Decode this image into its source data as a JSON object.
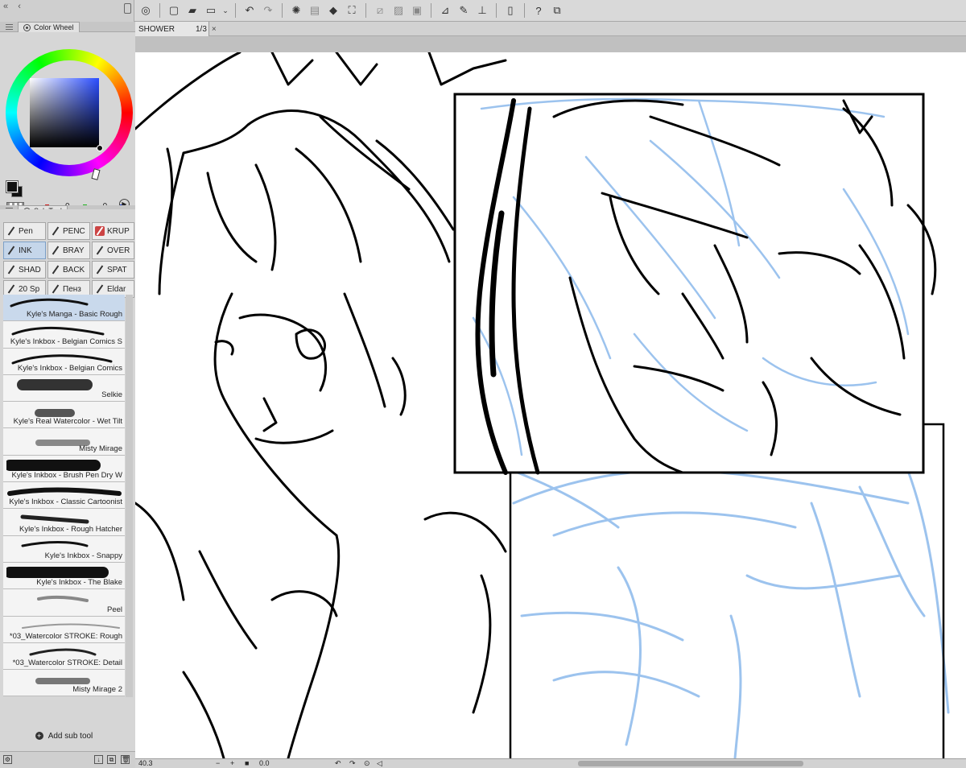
{
  "palette": {
    "color_wheel_tab": "Color Wheel",
    "rgb": {
      "r": "0",
      "g": "0",
      "b": "0"
    },
    "sub_tool_tab": "Sub Tool"
  },
  "subtool_buttons": [
    "Pen",
    "PENC",
    "KRUP",
    "INK",
    "BRAY",
    "OVER",
    "SHAD",
    "BACK",
    "SPAT",
    "20 Sp",
    "Пенз",
    "Eldar"
  ],
  "brushes": [
    "Kyle's Manga - Basic Rough",
    "Kyle's Inkbox - Belgian Comics S",
    "Kyle's Inkbox - Belgian Comics",
    "Selkie",
    "Kyle's Real Watercolor - Wet Tilt",
    "Misty Mirage",
    "Kyle's Inkbox - Brush Pen Dry W",
    "Kyle's Inkbox - Classic Cartoonist",
    "Kyle's Inkbox - Rough Hatcher",
    "Kyle's Inkbox - Snappy",
    "Kyle's Inkbox - The Blake",
    "Peel",
    "*03_Watercolor STROKE: Rough",
    "*03_Watercolor STROKE: Detail",
    "Misty Mirage 2"
  ],
  "add_sub_tool": "Add sub tool",
  "document": {
    "name": "SHOWER",
    "page": "1/3",
    "close": "×"
  },
  "status": {
    "zoom": "40.3",
    "rotation": "0.0"
  },
  "colors": {
    "sketch_blue": "#9cc3ee",
    "ink": "#000000",
    "selection": "#c5d6ea"
  }
}
